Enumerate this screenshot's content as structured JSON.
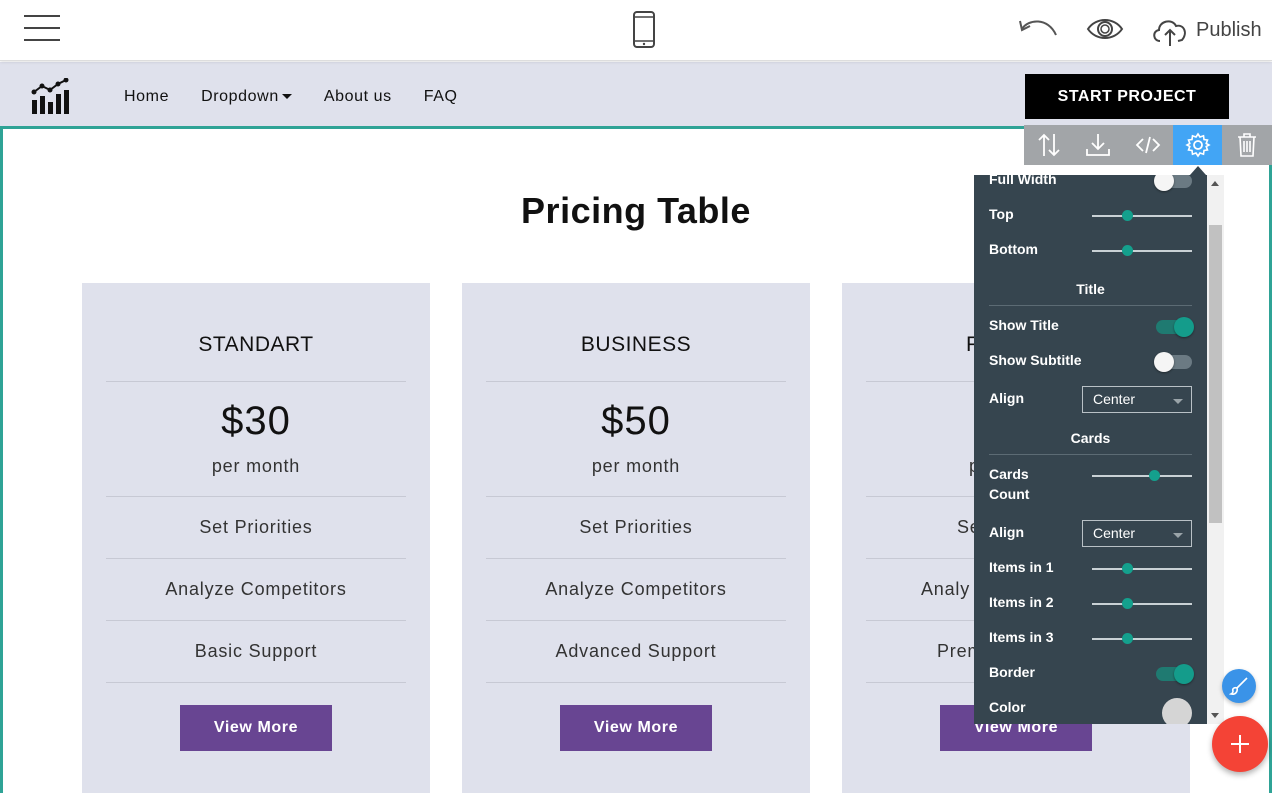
{
  "editor": {
    "publish_label": "Publish"
  },
  "site_nav": {
    "links": [
      "Home",
      "Dropdown",
      "About us",
      "FAQ"
    ],
    "cta": "START PROJECT"
  },
  "section": {
    "title": "Pricing Table",
    "cards": [
      {
        "plan": "STANDART",
        "currency": "$",
        "amount": "30",
        "period": "per month",
        "features": [
          "Set Priorities",
          "Analyze Competitors",
          "Basic Support"
        ],
        "button": "View More"
      },
      {
        "plan": "BUSINESS",
        "currency": "$",
        "amount": "50",
        "period": "per month",
        "features": [
          "Set Priorities",
          "Analyze Competitors",
          "Advanced Support"
        ],
        "button": "View More"
      },
      {
        "plan": "P",
        "currency": "",
        "amount": "",
        "period": "p",
        "features": [
          "Se",
          "Analy",
          "Prem"
        ],
        "button": "View More"
      }
    ]
  },
  "settings": {
    "full_width": {
      "label": "Full Width",
      "on": false
    },
    "top": {
      "label": "Top",
      "value": 0.35
    },
    "bottom": {
      "label": "Bottom",
      "value": 0.35
    },
    "title_header": "Title",
    "show_title": {
      "label": "Show Title",
      "on": true
    },
    "show_subtitle": {
      "label": "Show Subtitle",
      "on": false
    },
    "title_align": {
      "label": "Align",
      "value": "Center"
    },
    "cards_header": "Cards",
    "cards_count": {
      "label_line1": "Cards",
      "label_line2": "Count",
      "value": 0.62
    },
    "cards_align": {
      "label": "Align",
      "value": "Center"
    },
    "items_in_1": {
      "label": "Items in 1",
      "value": 0.35
    },
    "items_in_2": {
      "label": "Items in 2",
      "value": 0.35
    },
    "items_in_3": {
      "label": "Items in 3",
      "value": 0.35
    },
    "border": {
      "label": "Border",
      "on": true
    },
    "color": {
      "label": "Color",
      "value": "#d5d5d5"
    }
  },
  "colors": {
    "accent": "#2fa396",
    "button": "#684592",
    "panel": "#36454f",
    "active_tool": "#42a5f5",
    "fab_add": "#f44336"
  }
}
